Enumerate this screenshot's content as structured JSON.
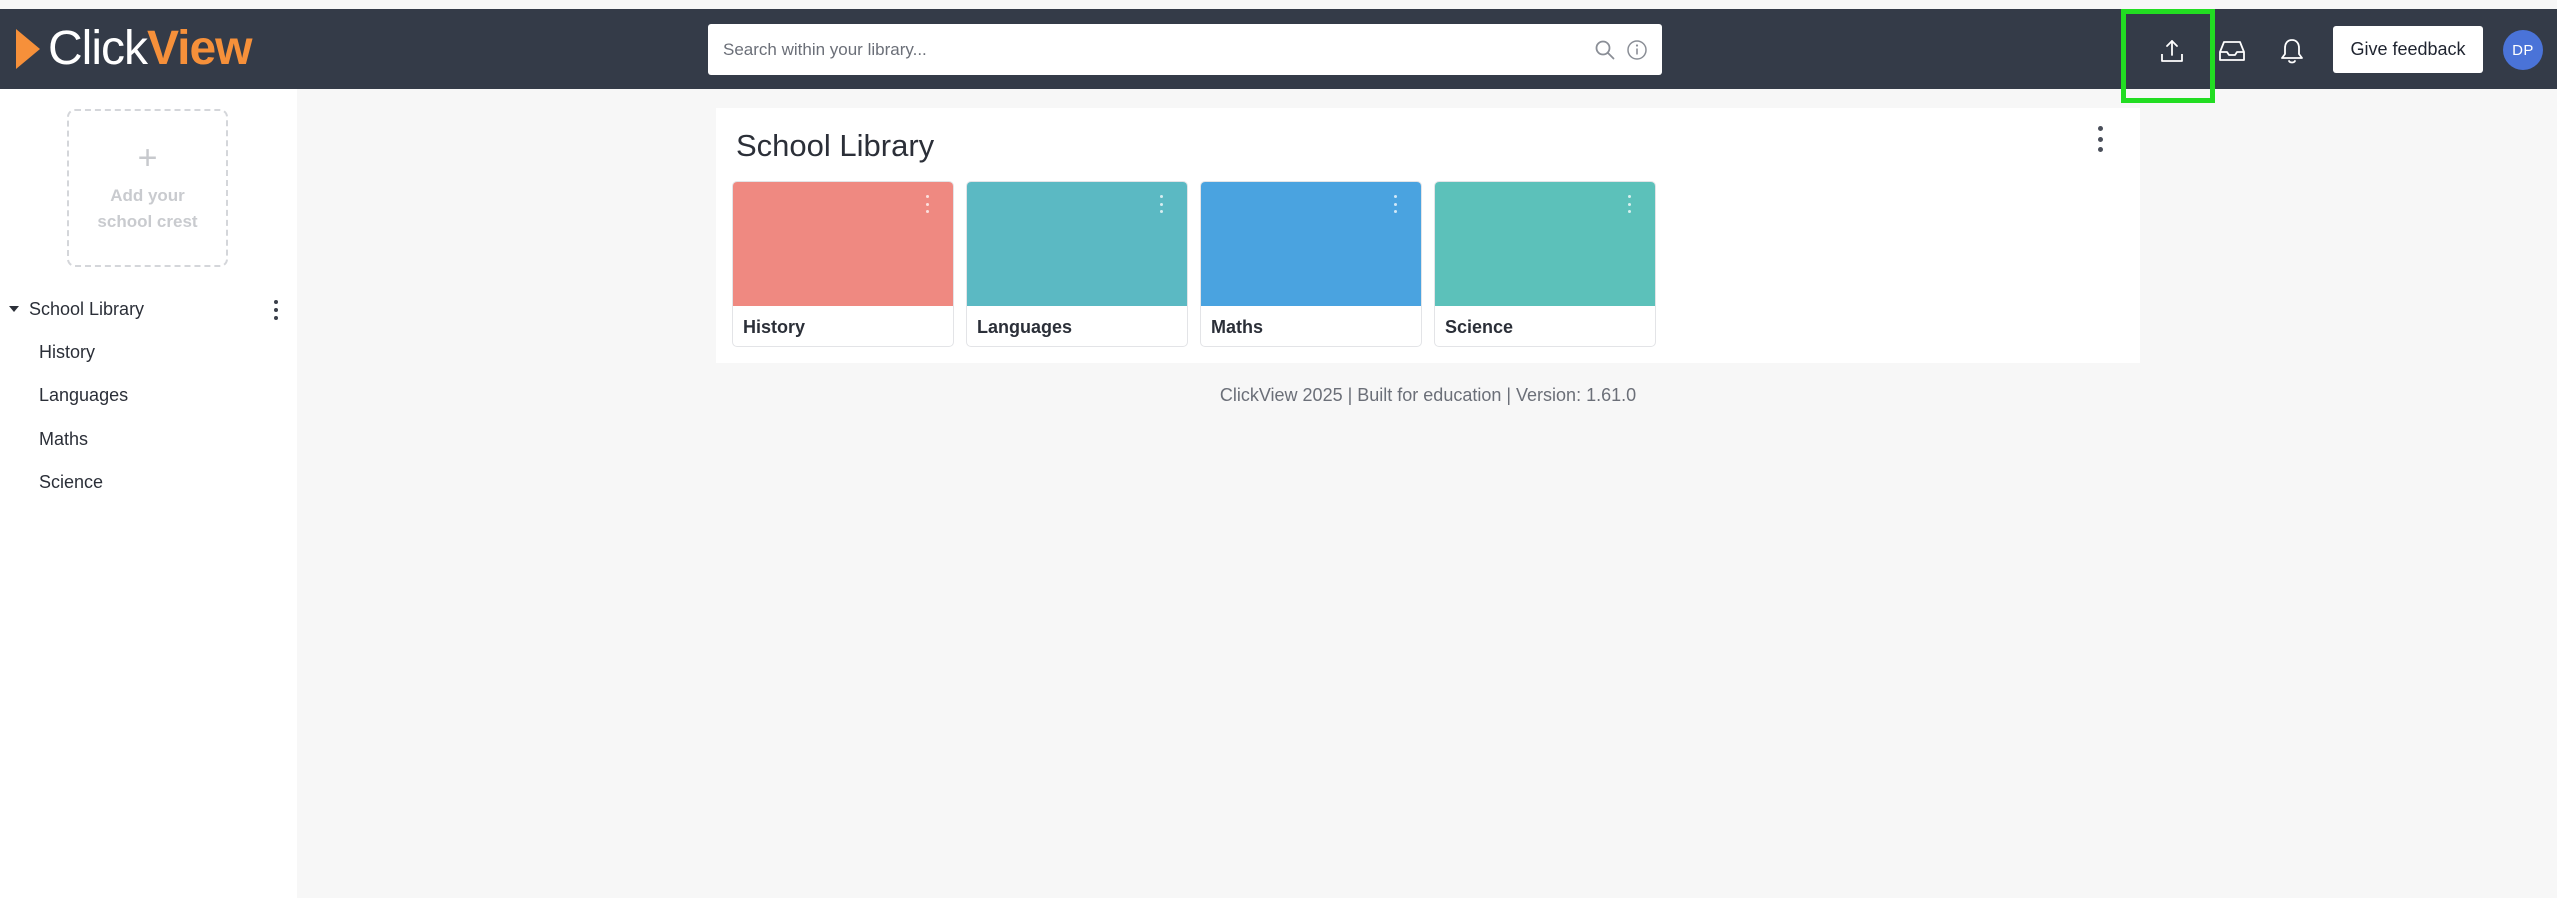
{
  "header": {
    "logo": {
      "part1": "Click",
      "part2": "View"
    },
    "search": {
      "placeholder": "Search within your library..."
    },
    "feedback_label": "Give feedback",
    "avatar_initials": "DP",
    "icons": [
      "upload-icon",
      "inbox-icon",
      "bell-icon"
    ],
    "highlight_color": "#22dd22"
  },
  "sidebar": {
    "crest": {
      "plus": "+",
      "line1": "Add your",
      "line2": "school crest"
    },
    "root": {
      "label": "School Library"
    },
    "items": [
      {
        "label": "History"
      },
      {
        "label": "Languages"
      },
      {
        "label": "Maths"
      },
      {
        "label": "Science"
      }
    ]
  },
  "main": {
    "title": "School Library",
    "tiles": [
      {
        "label": "History",
        "color": "#ef8981"
      },
      {
        "label": "Languages",
        "color": "#5bb9c3"
      },
      {
        "label": "Maths",
        "color": "#4aa3e0"
      },
      {
        "label": "Science",
        "color": "#5cc1ba"
      }
    ]
  },
  "footer": {
    "text": "ClickView 2025 | Built for education | Version: 1.61.0"
  },
  "colors": {
    "header_bg": "#343b48",
    "brand_orange": "#f6903a",
    "page_bg": "#f7f7f7",
    "avatar_bg": "#4a73d8"
  }
}
